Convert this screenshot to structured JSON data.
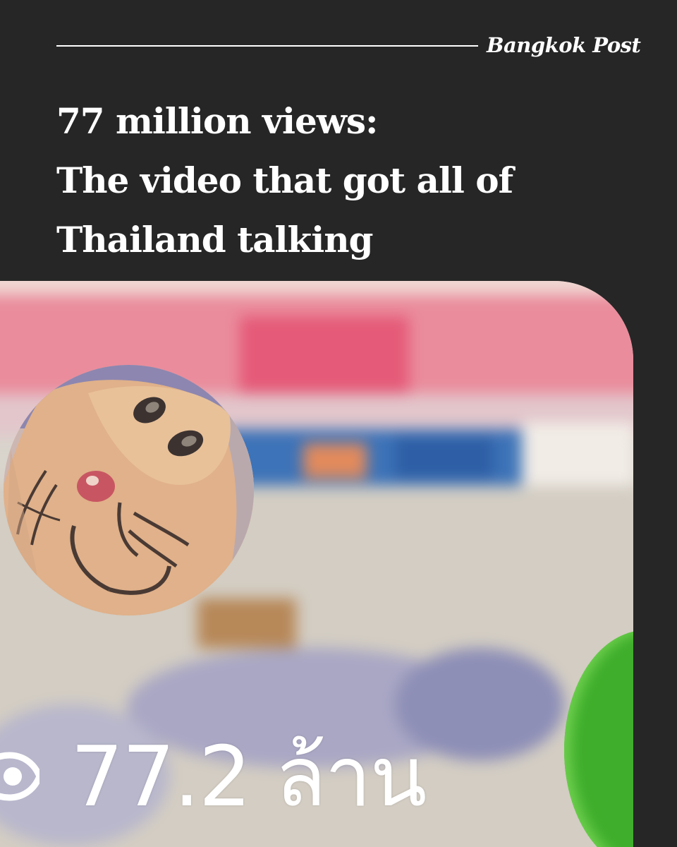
{
  "header": {
    "brand": "Bangkok Post"
  },
  "headline": {
    "line1": "77 million views:",
    "line2": "The video that got all of",
    "line3": "Thailand talking"
  },
  "media": {
    "view_count": "77.2 ล้าน",
    "icon": "eye-icon",
    "inset_icon": "cartoon-face-icon"
  },
  "colors": {
    "background": "#262626",
    "text": "#ffffff",
    "accent_green": "#3fae2c"
  }
}
